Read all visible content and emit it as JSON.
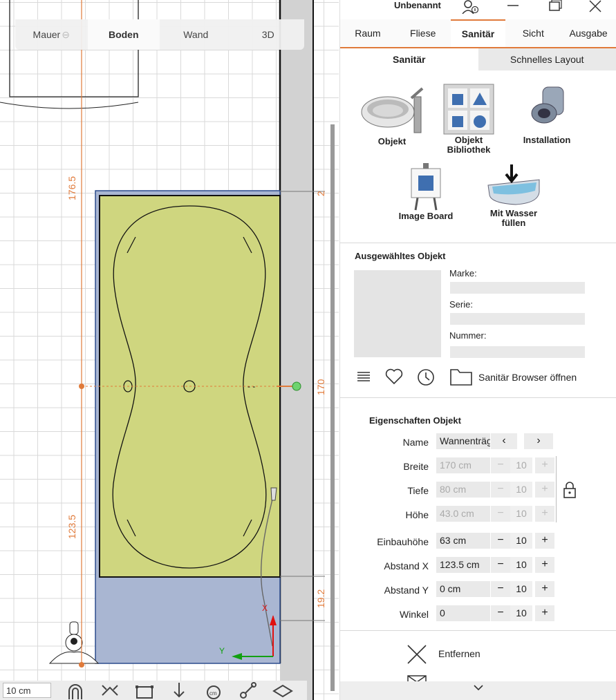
{
  "window": {
    "title": "Unbenannt"
  },
  "view_tabs": [
    {
      "label": "Mauer"
    },
    {
      "label": "Boden"
    },
    {
      "label": "Wand"
    },
    {
      "label": "3D"
    }
  ],
  "dimensions": {
    "d1": "176.5",
    "d2": "123.5",
    "d3": "170",
    "d4": "19.2",
    "d5": "2"
  },
  "axes": {
    "x": "X",
    "y": "Y"
  },
  "bottom": {
    "scale": "10 cm"
  },
  "main_tabs": [
    {
      "label": "Raum"
    },
    {
      "label": "Fliese"
    },
    {
      "label": "Sanitär"
    },
    {
      "label": "Sicht"
    },
    {
      "label": "Ausgabe"
    }
  ],
  "sub_tabs": [
    {
      "label": "Sanitär"
    },
    {
      "label": "Schnelles Layout"
    }
  ],
  "tiles": {
    "objekt": "Objekt",
    "bibliothek1": "Objekt",
    "bibliothek2": "Bibliothek",
    "installation": "Installation",
    "imageboard": "Image Board",
    "wasser1": "Mit Wasser",
    "wasser2": "füllen"
  },
  "selected": {
    "title": "Ausgewähltes Objekt",
    "marke": "Marke:",
    "serie": "Serie:",
    "nummer": "Nummer:",
    "browser": "Sanitär Browser öffnen"
  },
  "props": {
    "title": "Eigenschaften Objekt",
    "name_label": "Name",
    "name_value": "Wannenträg",
    "breite_label": "Breite",
    "breite_value": "170 cm",
    "breite_step": "10",
    "tiefe_label": "Tiefe",
    "tiefe_value": "80 cm",
    "tiefe_step": "10",
    "hoehe_label": "Höhe",
    "hoehe_value": "43.0 cm",
    "hoehe_step": "10",
    "einbau_label": "Einbauhöhe",
    "einbau_value": "63 cm",
    "einbau_step": "10",
    "ax_label": "Abstand X",
    "ax_value": "123.5 cm",
    "ax_step": "10",
    "ay_label": "Abstand Y",
    "ay_value": "0 cm",
    "ay_step": "10",
    "winkel_label": "Winkel",
    "winkel_value": "0",
    "winkel_step": "10",
    "minus": "−",
    "plus": "+"
  },
  "actions": {
    "entfernen": "Entfernen"
  },
  "colors": {
    "accent": "#e07a3a",
    "tub_fill": "#cfd67f",
    "base_fill": "#a9b6d2",
    "dim_line": "#e07a3a"
  }
}
